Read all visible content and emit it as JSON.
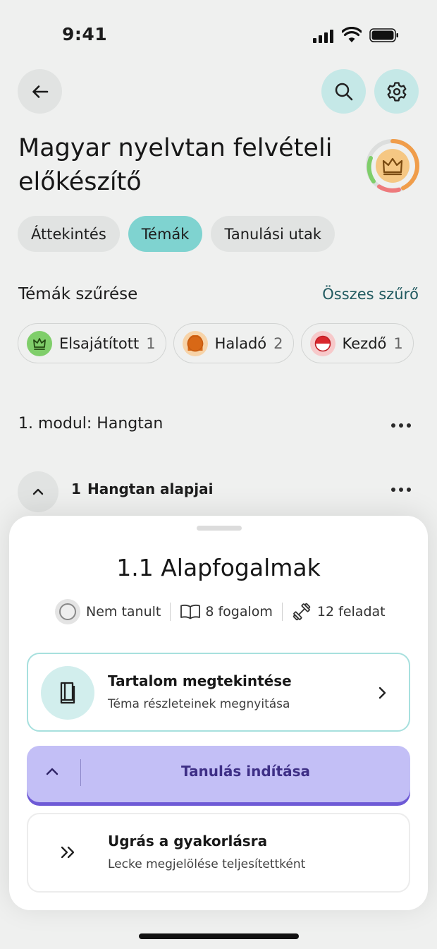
{
  "status_bar": {
    "time": "9:41"
  },
  "header": {
    "title": "Magyar nyelvtan felvételi előkészítő"
  },
  "tabs": [
    {
      "label": "Áttekintés",
      "active": false
    },
    {
      "label": "Témák",
      "active": true
    },
    {
      "label": "Tanulási utak",
      "active": false
    }
  ],
  "filters": {
    "title": "Témák szűrése",
    "all_link": "Összes szűrő",
    "chips": [
      {
        "label": "Elsajátított",
        "count": "1",
        "color": "#7fce6a"
      },
      {
        "label": "Haladó",
        "count": "2",
        "color": "#f09d4a"
      },
      {
        "label": "Kezdő",
        "count": "1",
        "color": "#e5484d"
      }
    ]
  },
  "module": {
    "title": "1. modul: Hangtan"
  },
  "topic": {
    "number": "1",
    "title": "Hangtan alapjai"
  },
  "sheet": {
    "title": "1.1 Alapfogalmak",
    "meta": {
      "status": "Nem tanult",
      "concepts": "8 fogalom",
      "exercises": "12 feladat"
    },
    "content_card": {
      "title": "Tartalom megtekintése",
      "subtitle": "Téma részleteinek megnyitása"
    },
    "start_button": "Tanulás indítása",
    "skip_card": {
      "title": "Ugrás a gyakorlásra",
      "subtitle": "Lecke megjelölése teljesítettként"
    }
  },
  "colors": {
    "accent_teal": "#7fd3d0",
    "primary_purple": "#c3bff6",
    "purple_text": "#3e2f86"
  }
}
